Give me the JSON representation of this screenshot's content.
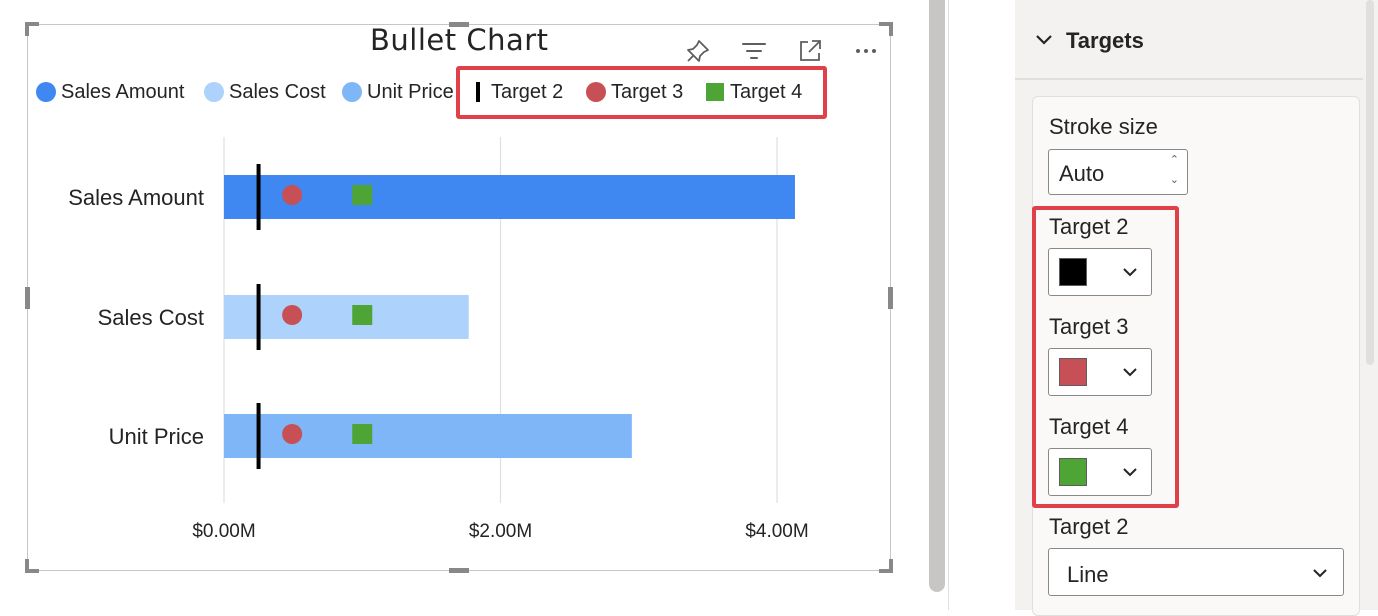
{
  "visual": {
    "title": "Bullet Chart",
    "header_icons": [
      "pin-icon",
      "filter-icon",
      "focus-mode-icon",
      "more-options-icon"
    ]
  },
  "legend": [
    {
      "label": "Sales Amount",
      "marker": "circle",
      "color": "#3F88F2"
    },
    {
      "label": "Sales Cost",
      "marker": "circle",
      "color": "#ADD2FB"
    },
    {
      "label": "Unit Price",
      "marker": "circle",
      "color": "#7FB6F7"
    },
    {
      "label": "Target 2",
      "marker": "line",
      "color": "#000000"
    },
    {
      "label": "Target 3",
      "marker": "circle",
      "color": "#C74F56"
    },
    {
      "label": "Target 4",
      "marker": "square",
      "color": "#4EA535"
    }
  ],
  "chart_data": {
    "type": "bar",
    "orientation": "horizontal",
    "title": "Bullet Chart",
    "categories": [
      "Sales Amount",
      "Sales Cost",
      "Unit Price"
    ],
    "series": [
      {
        "name": "Sales Amount",
        "values": [
          4.13,
          null,
          null
        ],
        "color": "#3F88F2"
      },
      {
        "name": "Sales Cost",
        "values": [
          null,
          1.77,
          null
        ],
        "color": "#ADD2FB"
      },
      {
        "name": "Unit Price",
        "values": [
          null,
          null,
          2.95
        ],
        "color": "#7FB6F7"
      }
    ],
    "targets": [
      {
        "name": "Target 2",
        "shape": "line",
        "color": "#000000",
        "values": [
          0.25,
          0.25,
          0.25
        ]
      },
      {
        "name": "Target 3",
        "shape": "circle",
        "color": "#C74F56",
        "values": [
          0.5,
          0.5,
          0.5
        ]
      },
      {
        "name": "Target 4",
        "shape": "square",
        "color": "#4EA535",
        "values": [
          1.0,
          1.0,
          1.0
        ]
      }
    ],
    "xlim": [
      0,
      4.6
    ],
    "xticks": [
      0,
      2,
      4
    ],
    "xtick_labels": [
      "$0.00M",
      "$2.00M",
      "$4.00M"
    ],
    "grid": true,
    "legend_position": "top-left"
  },
  "pane": {
    "section_title": "Targets",
    "stroke_label": "Stroke size",
    "stroke_value": "Auto",
    "color_fields": [
      {
        "label": "Target 2",
        "color": "#000000"
      },
      {
        "label": "Target 3",
        "color": "#C74F56"
      },
      {
        "label": "Target 4",
        "color": "#4EA535"
      }
    ],
    "shape_label": "Target 2",
    "shape_value": "Line"
  },
  "highlight_color": "#E04148"
}
